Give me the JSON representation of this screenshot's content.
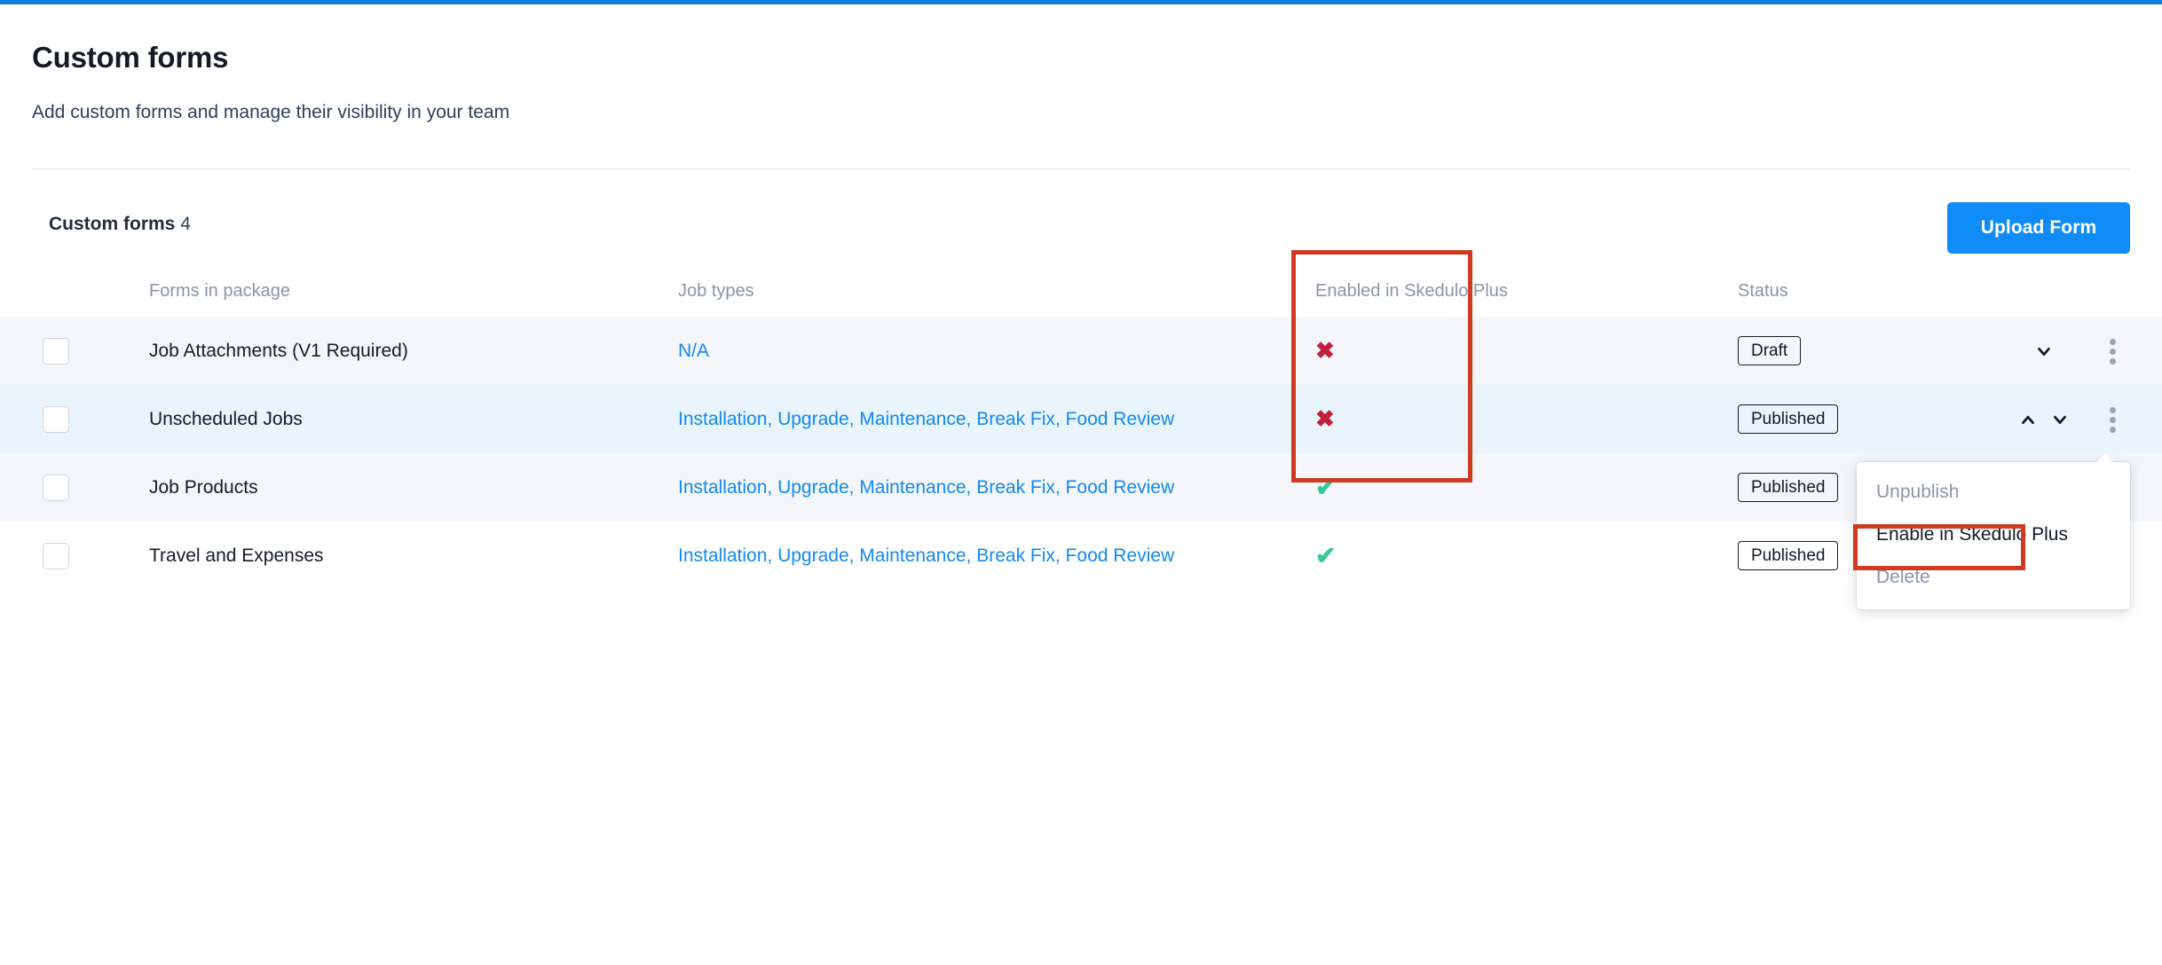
{
  "page": {
    "title": "Custom forms",
    "subtitle": "Add custom forms and manage their visibility in your team"
  },
  "section": {
    "title": "Custom forms",
    "count": "4",
    "upload_label": "Upload Form"
  },
  "table": {
    "headers": {
      "select": "",
      "name": "Forms in package",
      "job_types": "Job types",
      "enabled": "Enabled in Skedulo Plus",
      "status": "Status"
    },
    "rows": [
      {
        "name": "Job Attachments (V1 Required)",
        "job_types": "N/A",
        "enabled": "no",
        "enabled_glyph": "✖",
        "status": "Draft",
        "chevrons": [
          "down"
        ]
      },
      {
        "name": "Unscheduled Jobs",
        "job_types": "Installation, Upgrade, Maintenance, Break Fix, Food Review",
        "enabled": "no",
        "enabled_glyph": "✖",
        "status": "Published",
        "chevrons": [
          "up",
          "down"
        ]
      },
      {
        "name": "Job Products",
        "job_types": "Installation, Upgrade, Maintenance, Break Fix, Food Review",
        "enabled": "yes",
        "enabled_glyph": "✔",
        "status": "Published",
        "chevrons": []
      },
      {
        "name": "Travel and Expenses",
        "job_types": "Installation, Upgrade, Maintenance, Break Fix, Food Review",
        "enabled": "yes",
        "enabled_glyph": "✔",
        "status": "Published",
        "chevrons": []
      }
    ]
  },
  "context_menu": {
    "items": [
      {
        "label": "Unpublish",
        "state": "disabled"
      },
      {
        "label": "Enable in Skedulo Plus",
        "state": "active"
      },
      {
        "label": "Delete",
        "state": "disabled"
      }
    ]
  },
  "colors": {
    "accent_blue": "#108cf8",
    "top_bar_blue": "#0b7fd4",
    "link_blue": "#1189f5",
    "annotation_red": "#cf3b22",
    "cross_red": "#c31f3c",
    "check_green": "#38c895",
    "row_shade": "#f4f6f9",
    "row_highlight": "#e9f4fd"
  }
}
